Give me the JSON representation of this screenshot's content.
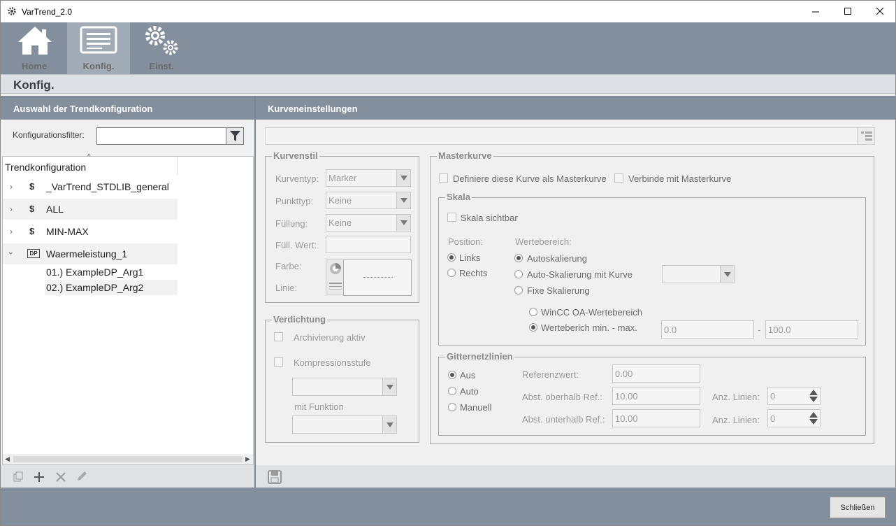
{
  "window": {
    "title": "VarTrend_2.0"
  },
  "nav": {
    "home": "Home",
    "konfig": "Konfig.",
    "einst": "Einst."
  },
  "page_title": "Konfig.",
  "left": {
    "header": "Auswahl der Trendkonfiguration",
    "filter_label": "Konfigurationsfilter:",
    "filter_value": "",
    "tree_header": "Trendkonfiguration",
    "items": [
      {
        "label": "_VarTrend_STDLIB_general",
        "type": "$"
      },
      {
        "label": "ALL",
        "type": "$"
      },
      {
        "label": "MIN-MAX",
        "type": "$"
      },
      {
        "label": "Waermeleistung_1",
        "type": "DP"
      }
    ],
    "children": [
      "01.) ExampleDP_Arg1",
      "02.) ExampleDP_Arg2"
    ]
  },
  "right": {
    "header": "Kurveneinstellungen",
    "kurvenstil": {
      "title": "Kurvenstil",
      "kurventyp_label": "Kurventyp:",
      "kurventyp": "Marker",
      "punkttyp_label": "Punkttyp:",
      "punkttyp": "Keine",
      "fuellung_label": "Füllung:",
      "fuellung": "Keine",
      "fuell_wert_label": "Füll. Wert:",
      "farbe_label": "Farbe:",
      "linie_label": "Linie:"
    },
    "verdichtung": {
      "title": "Verdichtung",
      "archivierung": "Archivierung aktiv",
      "kompression": "Kompressionsstufe",
      "mit_funktion": "mit Funktion"
    },
    "masterkurve": {
      "title": "Masterkurve",
      "define": "Definiere diese Kurve als Masterkurve",
      "connect": "Verbinde mit  Masterkurve"
    },
    "skala": {
      "title": "Skala",
      "visible": "Skala sichtbar",
      "position_label": "Position:",
      "links": "Links",
      "rechts": "Rechts",
      "wertebereich_label": "Wertebereich:",
      "auto": "Autoskalierung",
      "auto_kurve": "Auto-Skalierung mit Kurve",
      "fixe": "Fixe Skalierung",
      "wincc": "WinCC OA-Wertebereich",
      "minmax": "Werteberich min. - max.",
      "min": "0.0",
      "dash": "-",
      "max": "100.0"
    },
    "gitter": {
      "title": "Gitternetzlinien",
      "aus": "Aus",
      "auto": "Auto",
      "manuell": "Manuell",
      "ref_label": "Referenzwert:",
      "ref": "0.00",
      "above_label": "Abst. oberhalb Ref.:",
      "above": "10.00",
      "below_label": "Abst. unterhalb Ref.:",
      "below": "10.00",
      "anz_label": "Anz. Linien:",
      "anz1": "0",
      "anz2": "0"
    }
  },
  "close_button": "Schließen"
}
